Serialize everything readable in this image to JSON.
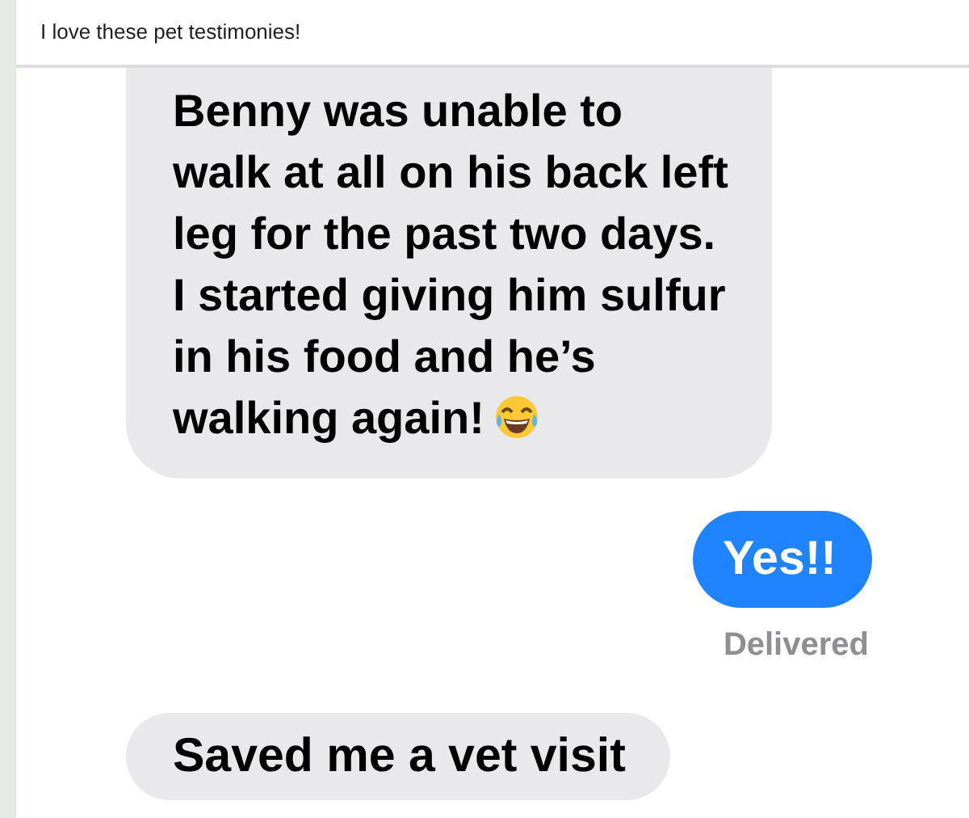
{
  "post": {
    "caption": "I love these pet testimonies!"
  },
  "messages": [
    {
      "kind": "received",
      "text": "Benny was unable to walk at all on his back left leg for the past two days.  I started giving him sulfur in his food and he’s walking again!",
      "emoji": true
    },
    {
      "kind": "sent",
      "text": "Yes!!",
      "status": "Delivered"
    },
    {
      "kind": "received",
      "text": "Saved me a vet visit",
      "emoji": false
    }
  ]
}
